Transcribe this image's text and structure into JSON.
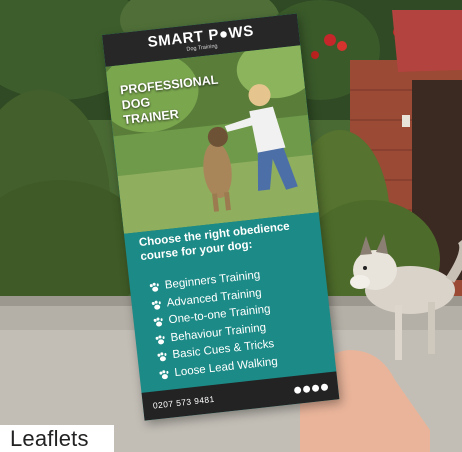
{
  "flyer": {
    "brand": "SMART P●WS",
    "brand_sub": "Dog Training",
    "photo_title_lines": [
      "PROFESSIONAL",
      "DOG",
      "TRAINER"
    ],
    "headline": "Choose the right obedience course for your dog:",
    "courses": [
      "Beginners Training",
      "Advanced Training",
      "One-to-one Training",
      "Behaviour Training",
      "Basic Cues & Tricks",
      "Loose Lead Walking"
    ],
    "phone": "0207 573 9481",
    "social_icons": [
      "facebook-icon",
      "twitter-icon",
      "instagram-icon",
      "web-icon"
    ]
  },
  "caption": "Leaflets",
  "colors": {
    "teal": "#1c8a86",
    "header_dark": "#272727",
    "footer_dark": "#232323",
    "hedge": "#3e5a2a",
    "brick": "#9a4a35"
  }
}
